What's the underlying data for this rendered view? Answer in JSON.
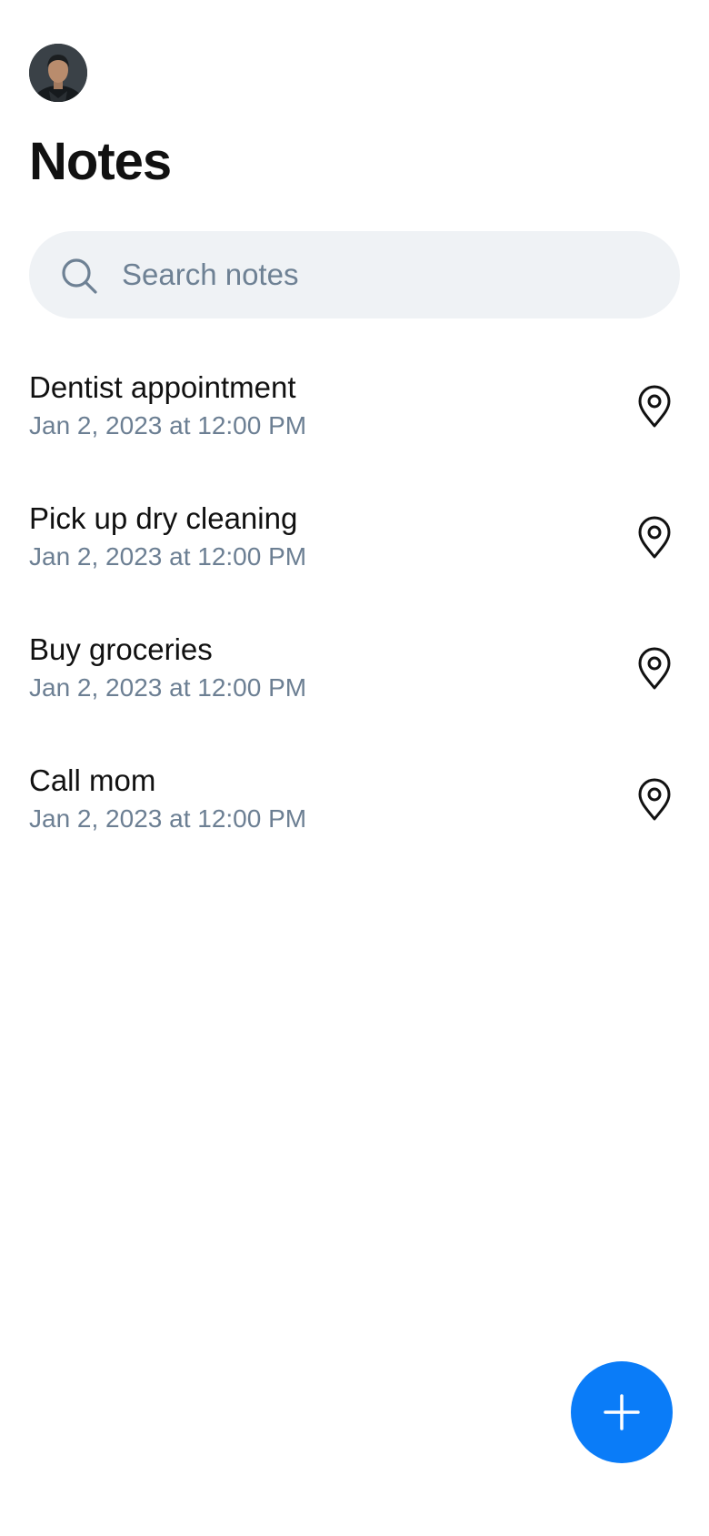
{
  "header": {
    "avatar_icon": "user-avatar",
    "title": "Notes"
  },
  "search": {
    "icon": "search-icon",
    "placeholder": "Search notes",
    "value": ""
  },
  "notes": [
    {
      "title": "Dentist appointment",
      "date": "Jan 2, 2023 at 12:00 PM",
      "icon": "location-pin-icon"
    },
    {
      "title": "Pick up dry cleaning",
      "date": "Jan 2, 2023 at 12:00 PM",
      "icon": "location-pin-icon"
    },
    {
      "title": "Buy groceries",
      "date": "Jan 2, 2023 at 12:00 PM",
      "icon": "location-pin-icon"
    },
    {
      "title": "Call mom",
      "date": "Jan 2, 2023 at 12:00 PM",
      "icon": "location-pin-icon"
    }
  ],
  "fab": {
    "icon": "plus-icon",
    "color": "#0a7cf8"
  },
  "colors": {
    "accent": "#0a7cf8",
    "search_background": "#eff2f5",
    "secondary_text": "#6c7f93",
    "primary_text": "#111111"
  }
}
